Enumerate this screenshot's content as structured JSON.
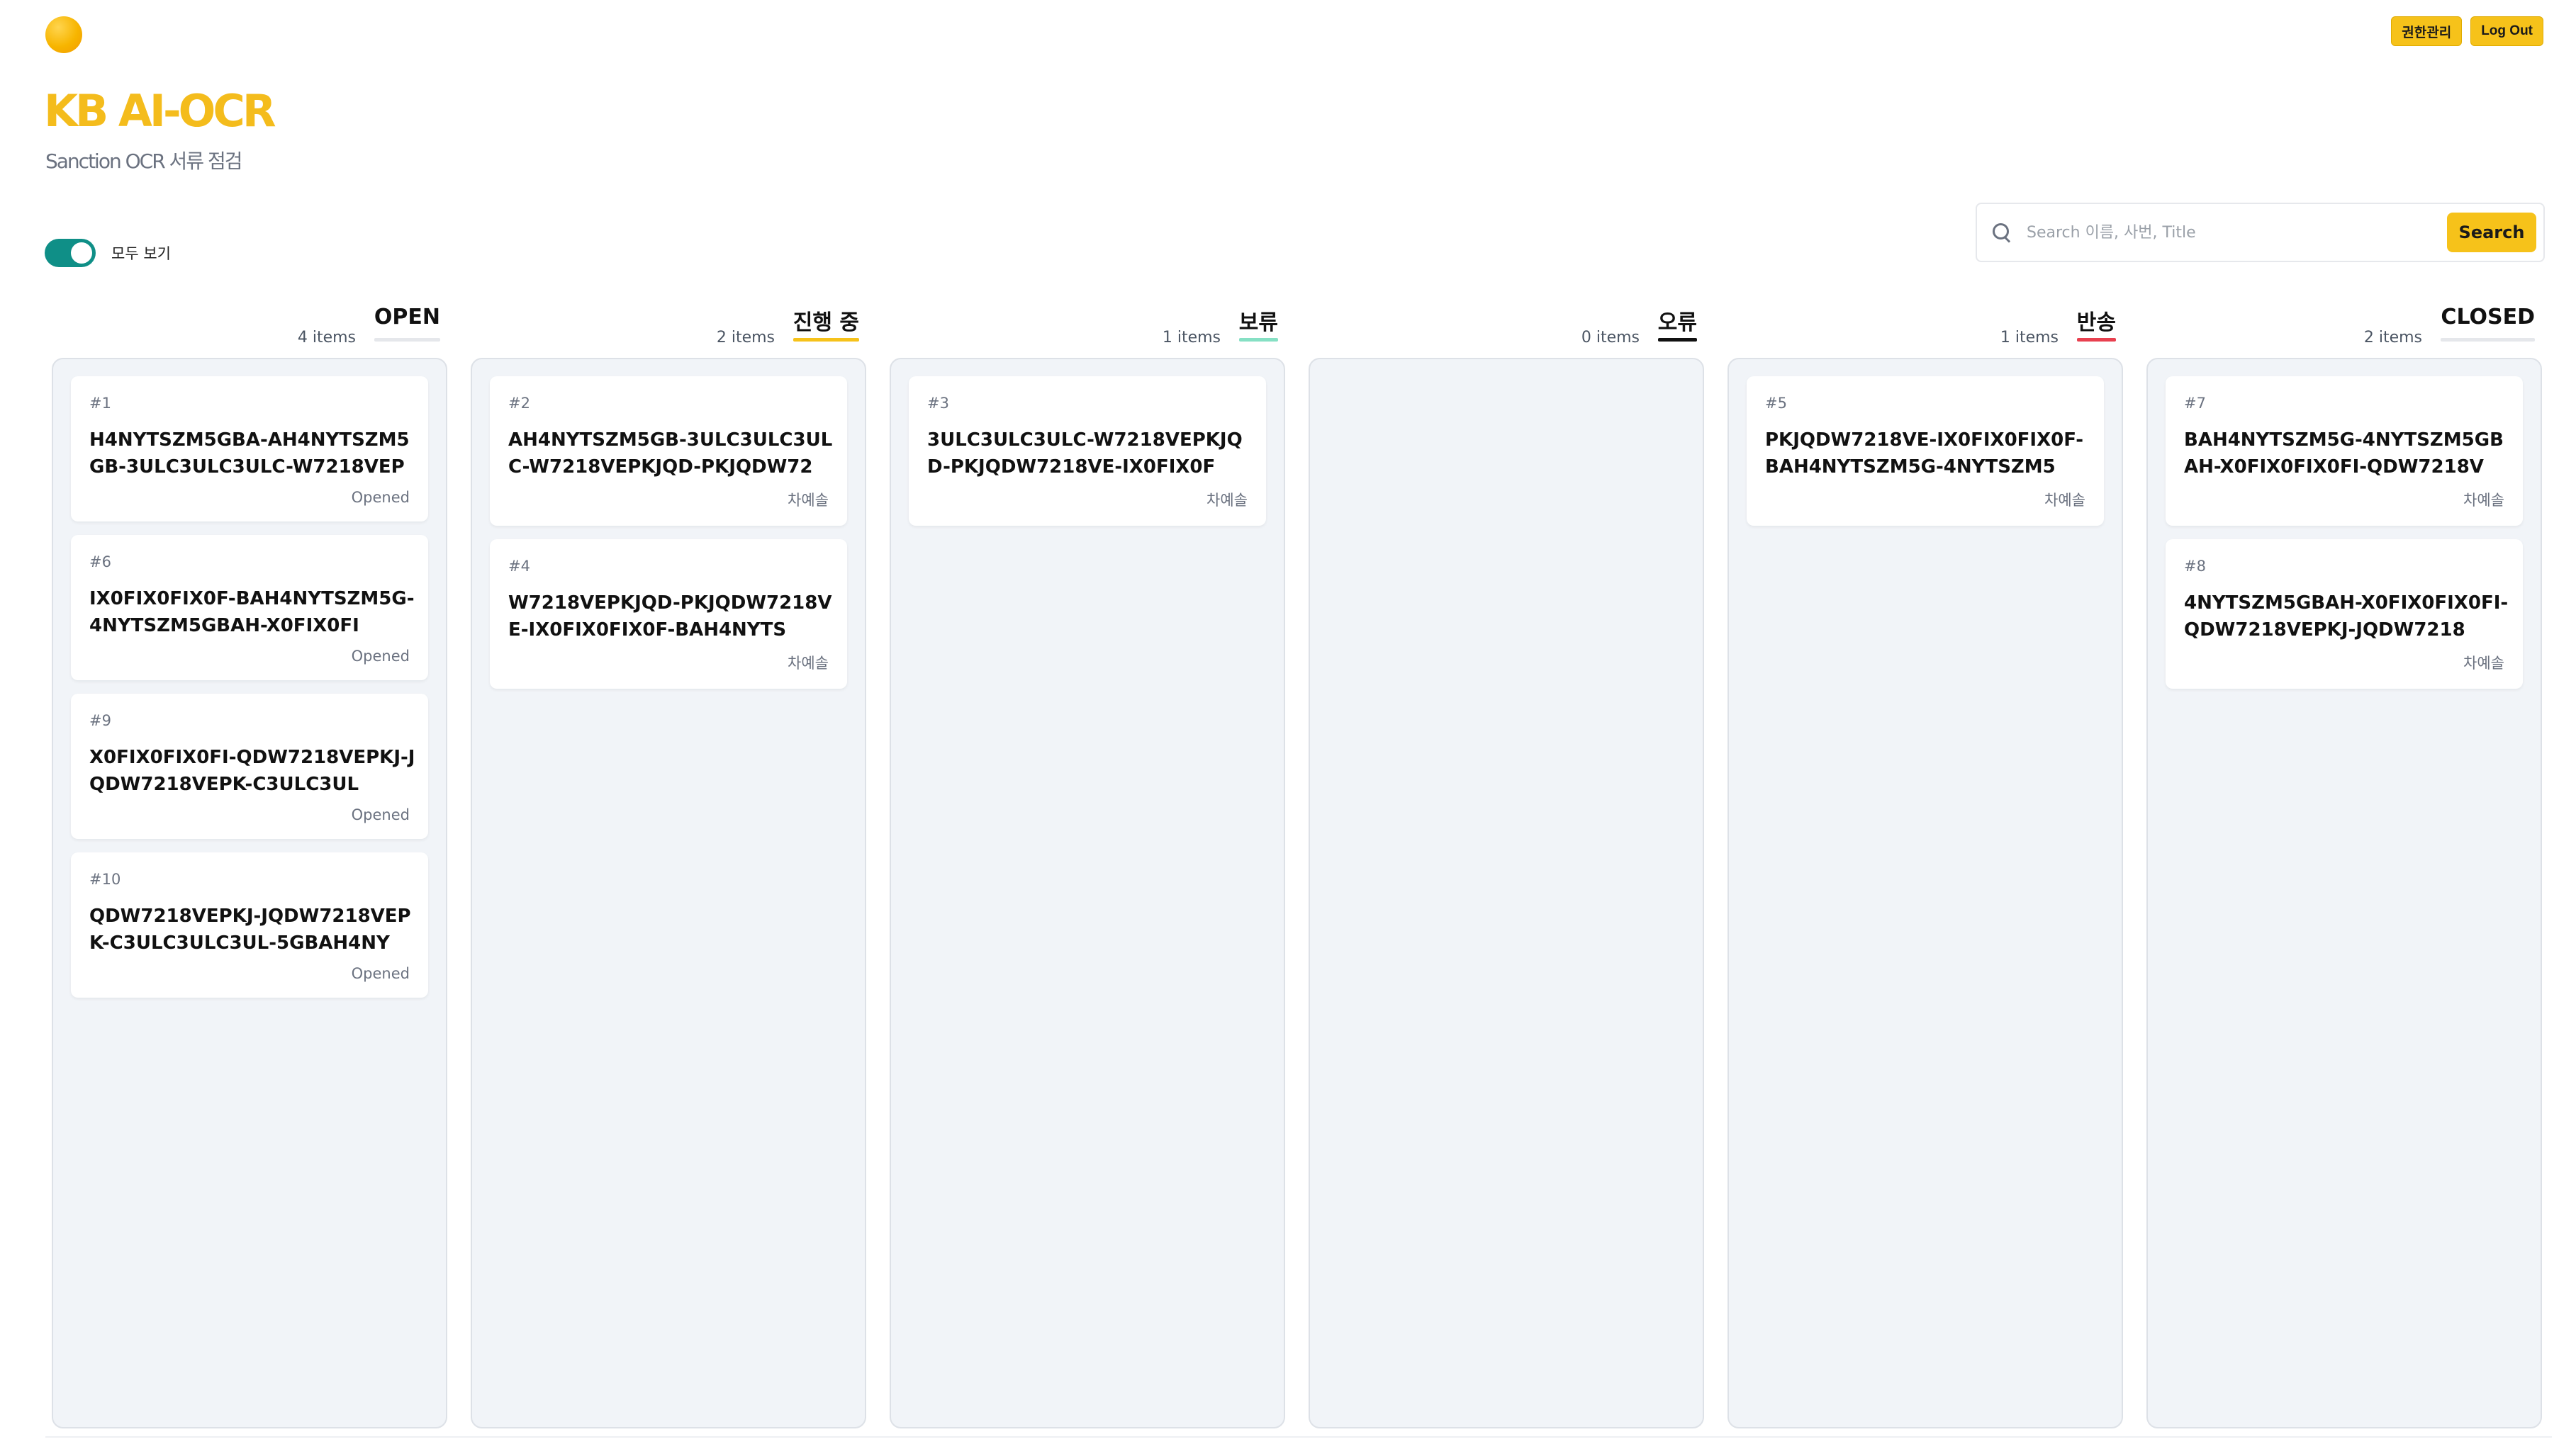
{
  "header": {
    "title": "KB AI-OCR",
    "subtitle": "Sanction OCR 서류 점검",
    "actions": {
      "permissions": "권한관리",
      "logout": "Log Out"
    }
  },
  "toggle": {
    "label": "모두 보기",
    "on": true
  },
  "search": {
    "placeholder": "Search 이름, 사번, Title",
    "value": "",
    "button": "Search"
  },
  "colors": {
    "accent": "#f6c21a",
    "toggle": "#0f8f87",
    "column_bg": "#f1f4f8"
  },
  "columns": [
    {
      "title": "OPEN",
      "count": "4 items",
      "underline": "#e5e7eb",
      "cards": [
        {
          "num": "#1",
          "title": "H4NYTSZM5GBA-AH4NYTSZM5GB-3ULC3ULC3ULC-W7218VEP",
          "meta": "Opened"
        },
        {
          "num": "#6",
          "title": "IX0FIX0FIX0F-BAH4NYTSZM5G-4NYTSZM5GBAH-X0FIX0FI",
          "meta": "Opened"
        },
        {
          "num": "#9",
          "title": "X0FIX0FIX0FI-QDW7218VEPKJ-JQDW7218VEPK-C3ULC3UL",
          "meta": "Opened"
        },
        {
          "num": "#10",
          "title": "QDW7218VEPKJ-JQDW7218VEPK-C3ULC3ULC3UL-5GBAH4NY",
          "meta": "Opened"
        }
      ]
    },
    {
      "title": "진행 중",
      "count": "2 items",
      "underline": "#f6c21a",
      "cards": [
        {
          "num": "#2",
          "title": "AH4NYTSZM5GB-3ULC3ULC3ULC-W7218VEPKJQD-PKJQDW72",
          "meta": "차예솔"
        },
        {
          "num": "#4",
          "title": "W7218VEPKJQD-PKJQDW7218VE-IX0FIX0FIX0F-BAH4NYTS",
          "meta": "차예솔"
        }
      ]
    },
    {
      "title": "보류",
      "count": "1 items",
      "underline": "#86e0c4",
      "cards": [
        {
          "num": "#3",
          "title": "3ULC3ULC3ULC-W7218VEPKJQD-PKJQDW7218VE-IX0FIX0F",
          "meta": "차예솔"
        }
      ]
    },
    {
      "title": "오류",
      "count": "0 items",
      "underline": "#111111",
      "cards": []
    },
    {
      "title": "반송",
      "count": "1 items",
      "underline": "#e8404f",
      "cards": [
        {
          "num": "#5",
          "title": "PKJQDW7218VE-IX0FIX0FIX0F-BAH4NYTSZM5G-4NYTSZM5",
          "meta": "차예솔"
        }
      ]
    },
    {
      "title": "CLOSED",
      "count": "2 items",
      "underline": "#e5e7eb",
      "cards": [
        {
          "num": "#7",
          "title": "BAH4NYTSZM5G-4NYTSZM5GBAH-X0FIX0FIX0FI-QDW7218V",
          "meta": "차예솔"
        },
        {
          "num": "#8",
          "title": "4NYTSZM5GBAH-X0FIX0FIX0FI-QDW7218VEPKJ-JQDW7218",
          "meta": "차예솔"
        }
      ]
    }
  ]
}
